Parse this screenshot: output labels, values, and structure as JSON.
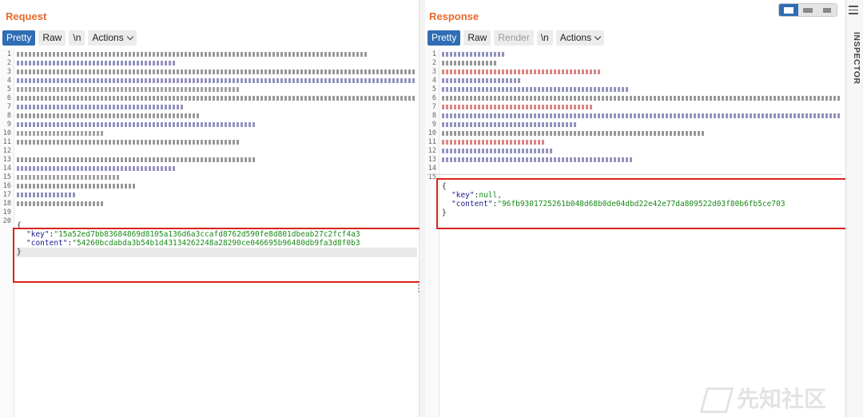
{
  "request": {
    "title": "Request",
    "tabs": [
      "Pretty",
      "Raw",
      "\\n",
      "Actions"
    ],
    "line_numbers": [
      "1",
      "2",
      "3",
      "4",
      "5",
      "6",
      "7",
      "8",
      "9",
      "10",
      "11",
      "12",
      "13",
      "14",
      "15",
      "16",
      "17",
      "18",
      "19",
      "20"
    ],
    "json_body": {
      "open": "{",
      "key_name": "\"key\"",
      "key_value": "\"15a52ed7bb83684869d8105a136d6a3ccafd8762d590fe8d801dbeab27c2fcf4a3",
      "content_name": "\"content\"",
      "content_value": "\"54260bcdabda3b54b1d43134262248a28290ce046695b96480db9fa3d8f0b3",
      "close": "}"
    }
  },
  "response": {
    "title": "Response",
    "tabs": [
      "Pretty",
      "Raw",
      "Render",
      "\\n",
      "Actions"
    ],
    "line_numbers": [
      "1",
      "2",
      "3",
      "4",
      "5",
      "6",
      "7",
      "8",
      "9",
      "10",
      "11",
      "12",
      "13",
      "14",
      "15"
    ],
    "json_body": {
      "open": "{",
      "key_name": "\"key\"",
      "key_value": "null,",
      "content_name": "\"content\"",
      "content_value": "\"96fb9301725261b048d68b0de04dbd22e42e77da809522d03f80b6fb5ce703",
      "close": "}"
    }
  },
  "inspector": {
    "label": "INSPECTOR"
  },
  "watermark": {
    "text": "先知社区"
  },
  "colors": {
    "accent": "#2f6db5",
    "title": "#e8692a",
    "highlight_box": "#d9221c",
    "json_key": "#1b1b8c",
    "json_string": "#1a8a1a"
  },
  "icons": [
    "layout-split-icon",
    "layout-horizontal-icon",
    "layout-single-icon",
    "hamburger-menu-icon",
    "chevron-down-icon",
    "kebab-icon"
  ]
}
